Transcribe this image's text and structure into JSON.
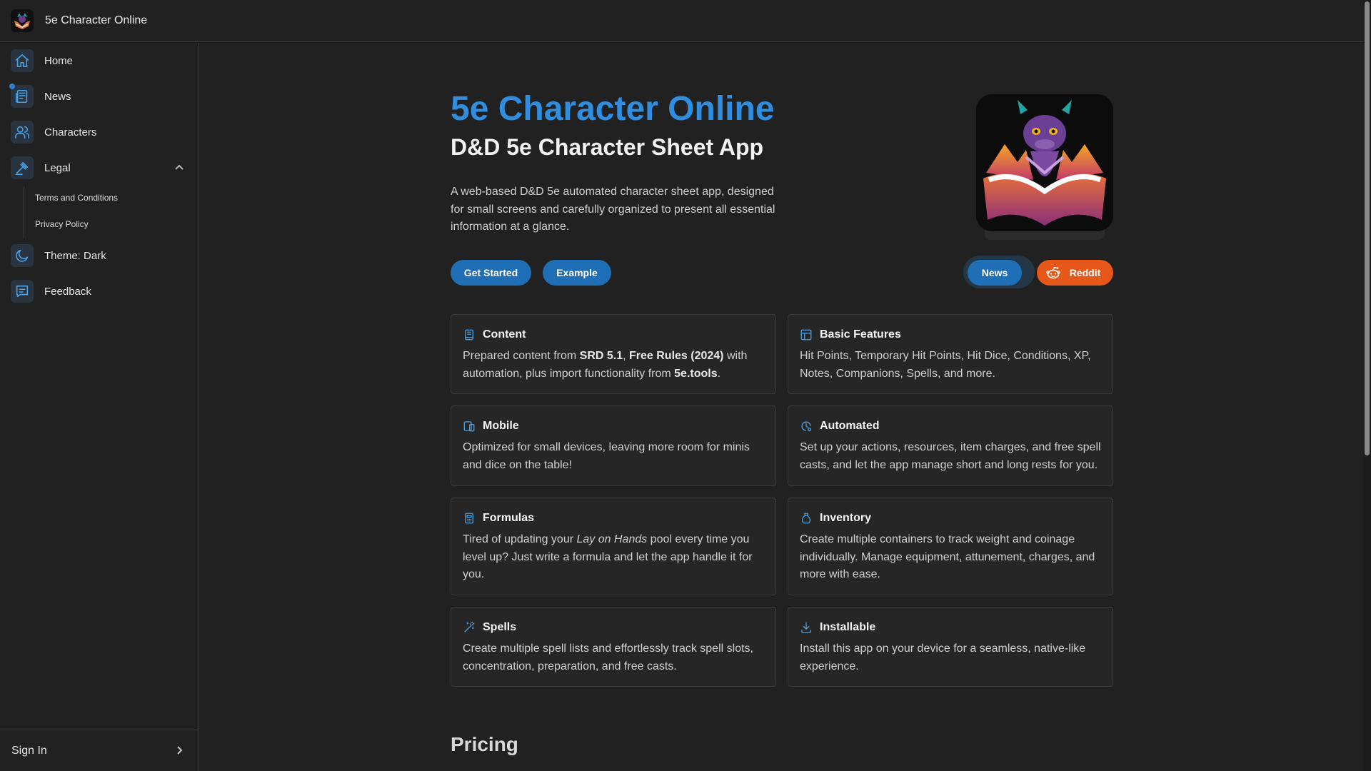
{
  "header": {
    "title": "5e Character Online"
  },
  "sidebar": {
    "items": [
      {
        "label": "Home",
        "icon": "home-icon"
      },
      {
        "label": "News",
        "icon": "newspaper-icon"
      },
      {
        "label": "Characters",
        "icon": "users-icon"
      },
      {
        "label": "Legal",
        "icon": "gavel-icon"
      },
      {
        "label": "Theme: Dark",
        "icon": "moon-icon"
      },
      {
        "label": "Feedback",
        "icon": "message-icon"
      }
    ],
    "legal_sub": [
      {
        "label": "Terms and Conditions"
      },
      {
        "label": "Privacy Policy"
      }
    ],
    "sign_in": "Sign In"
  },
  "hero": {
    "title": "5e Character Online",
    "subtitle": "D&D 5e Character Sheet App",
    "description": "A web-based D&D 5e automated character sheet app, designed for small screens and carefully organized to present all essential information at a glance.",
    "buttons": {
      "get_started": "Get Started",
      "example": "Example",
      "news": "News",
      "reddit": "Reddit"
    }
  },
  "features": [
    {
      "title": "Content",
      "icon": "book-icon",
      "parts": [
        "Prepared content from ",
        "SRD 5.1",
        ", ",
        "Free Rules (2024)",
        " with automation, plus import functionality from ",
        "5e.tools",
        "."
      ]
    },
    {
      "title": "Basic Features",
      "icon": "layout-icon",
      "text": "Hit Points, Temporary Hit Points, Hit Dice, Conditions, XP, Notes, Companions, Spells, and more."
    },
    {
      "title": "Mobile",
      "icon": "devices-icon",
      "text": "Optimized for small devices, leaving more room for minis and dice on the table!"
    },
    {
      "title": "Automated",
      "icon": "clock-gear-icon",
      "text": "Set up your actions, resources, item charges, and free spell casts, and let the app manage short and long rests for you."
    },
    {
      "title": "Formulas",
      "icon": "calculator-icon",
      "parts": [
        "Tired of updating your ",
        "Lay on Hands",
        " pool every time you level up? Just write a formula and let the app handle it for you."
      ]
    },
    {
      "title": "Inventory",
      "icon": "bag-icon",
      "text": "Create multiple containers to track weight and coinage individually. Manage equipment, attunement, charges, and more with ease."
    },
    {
      "title": "Spells",
      "icon": "wand-icon",
      "text": "Create multiple spell lists and effortlessly track spell slots, concentration, preparation, and free casts."
    },
    {
      "title": "Installable",
      "icon": "download-icon",
      "text": "Install this app on your device for a seamless, native-like experience."
    }
  ],
  "pricing": {
    "heading": "Pricing"
  },
  "colors": {
    "accent": "#2f8ee0",
    "button_blue": "#1e6fb6",
    "reddit": "#e6571a",
    "background": "#212121"
  }
}
